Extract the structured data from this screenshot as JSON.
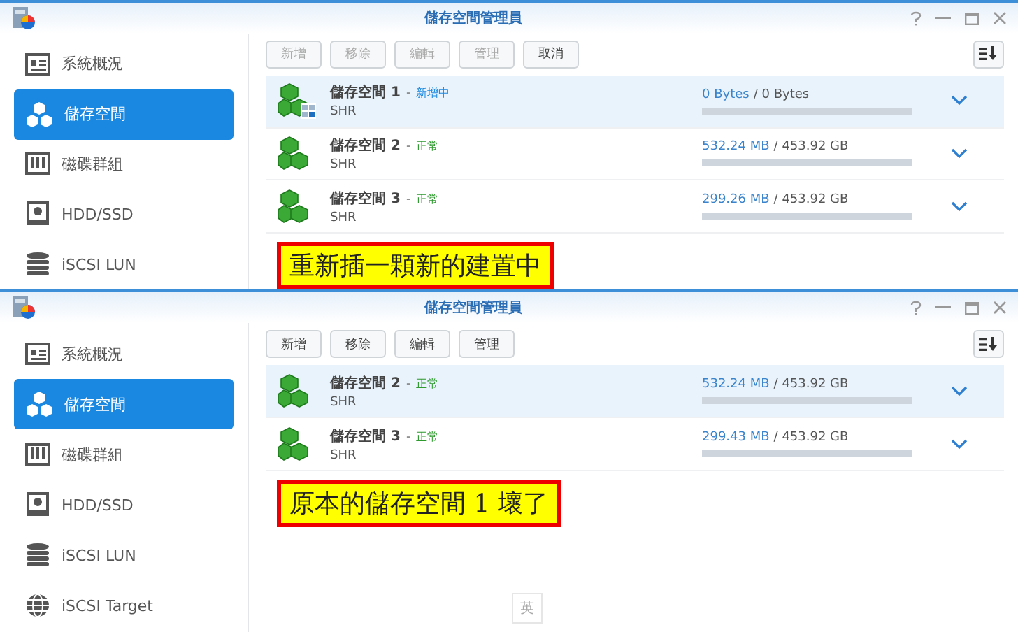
{
  "panes": [
    {
      "window": {
        "title": "儲存空間管理員"
      },
      "sidebar": {
        "items": [
          {
            "label": "系統概況",
            "kind": "overview",
            "selected": false
          },
          {
            "label": "儲存空間",
            "kind": "volume",
            "selected": true
          },
          {
            "label": "磁碟群組",
            "kind": "group",
            "selected": false
          },
          {
            "label": "HDD/SSD",
            "kind": "disk",
            "selected": false
          },
          {
            "label": "iSCSI LUN",
            "kind": "lun",
            "selected": false
          }
        ]
      },
      "toolbar": [
        {
          "label": "新增",
          "disabled": true
        },
        {
          "label": "移除",
          "disabled": true
        },
        {
          "label": "編輯",
          "disabled": true
        },
        {
          "label": "管理",
          "disabled": true
        },
        {
          "label": "取消",
          "disabled": false
        }
      ],
      "volumes": [
        {
          "name": "儲存空間 1",
          "separator": "-",
          "status": "新增中",
          "kind": "creating",
          "raid": "SHR",
          "used": "0 Bytes",
          "total": "/ 0 Bytes",
          "selected": true
        },
        {
          "name": "儲存空間 2",
          "separator": "-",
          "status": "正常",
          "kind": "normal",
          "raid": "SHR",
          "used": "532.24 MB",
          "total": "/ 453.92 GB",
          "selected": false
        },
        {
          "name": "儲存空間 3",
          "separator": "-",
          "status": "正常",
          "kind": "normal",
          "raid": "SHR",
          "used": "299.26 MB",
          "total": "/ 453.92 GB",
          "selected": false
        }
      ],
      "annotation": "重新插一顆新的建置中"
    },
    {
      "window": {
        "title": "儲存空間管理員"
      },
      "sidebar": {
        "items": [
          {
            "label": "系統概況",
            "kind": "overview",
            "selected": false
          },
          {
            "label": "儲存空間",
            "kind": "volume",
            "selected": true
          },
          {
            "label": "磁碟群組",
            "kind": "group",
            "selected": false
          },
          {
            "label": "HDD/SSD",
            "kind": "disk",
            "selected": false
          },
          {
            "label": "iSCSI LUN",
            "kind": "lun",
            "selected": false
          },
          {
            "label": "iSCSI Target",
            "kind": "target",
            "selected": false
          }
        ]
      },
      "toolbar": [
        {
          "label": "新增",
          "disabled": false
        },
        {
          "label": "移除",
          "disabled": false
        },
        {
          "label": "編輯",
          "disabled": false
        },
        {
          "label": "管理",
          "disabled": false
        }
      ],
      "volumes": [
        {
          "name": "儲存空間 2",
          "separator": "-",
          "status": "正常",
          "kind": "normal",
          "raid": "SHR",
          "used": "532.24 MB",
          "total": "/ 453.92 GB",
          "selected": true
        },
        {
          "name": "儲存空間 3",
          "separator": "-",
          "status": "正常",
          "kind": "normal",
          "raid": "SHR",
          "used": "299.43 MB",
          "total": "/ 453.92 GB",
          "selected": false
        }
      ],
      "annotation": "原本的儲存空間 1 壞了",
      "ime_indicator": "英"
    }
  ]
}
